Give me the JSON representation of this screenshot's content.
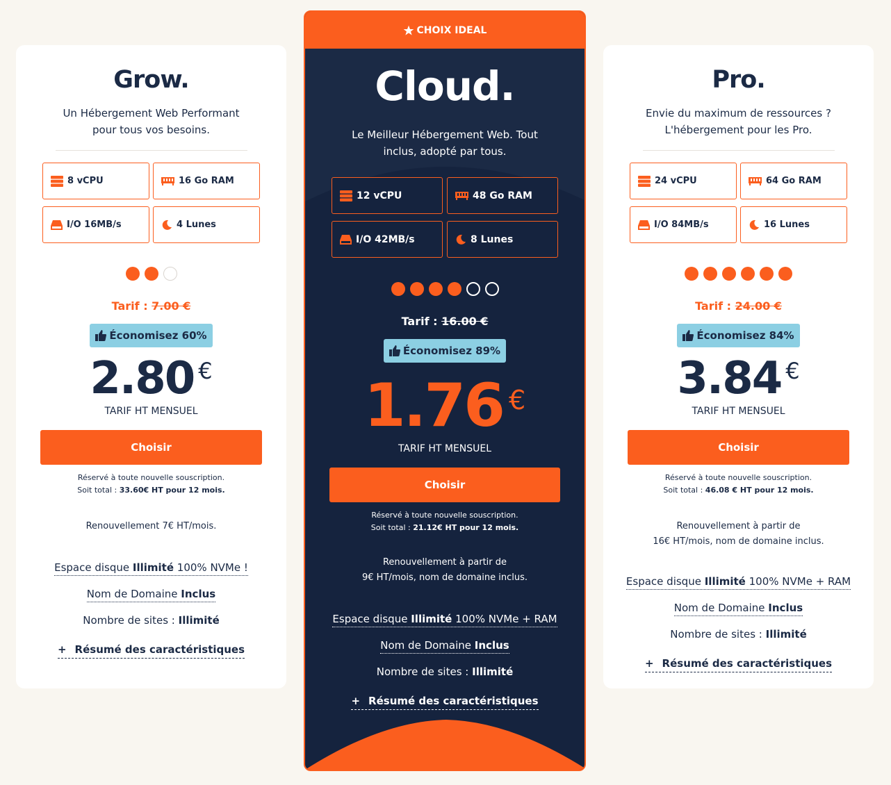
{
  "colors": {
    "accent": "#fb5e1e",
    "navy": "#15233e",
    "badge": "#8ccfe3",
    "background": "#f9f6f0"
  },
  "labels": {
    "tarif": "Tarif :",
    "tarif_ht": "TARIF HT MENSUEL",
    "choose": "Choisir",
    "reserved": "Réservé à toute nouvelle souscription.",
    "soit_total": "Soit total :",
    "disk_prefix": "Espace disque",
    "illimite": "Illimité",
    "domain_prefix": "Nom de Domaine",
    "inclus": "Inclus",
    "sites_prefix": "Nombre de sites :",
    "summary": "Résumé des caractéristiques",
    "plus": "+"
  },
  "icons": [
    "server-icon",
    "ram-icon",
    "disk-icon",
    "moon-icon",
    "star-icon",
    "thumbs-up-icon",
    "plus-icon"
  ],
  "plans": [
    {
      "id": "grow",
      "name": "Grow.",
      "desc_1": "Un Hébergement Web Performant",
      "desc_2": "pour tous vos besoins.",
      "vcpu": "8 vCPU",
      "ram": "16 Go RAM",
      "io": "I/O 16MB/s",
      "lunes": "4 Lunes",
      "level": 2,
      "level_max": 3,
      "old_price": "7.00 €",
      "save": "Économisez 60%",
      "price": "2.80",
      "currency": "€",
      "total": "33.60€ HT pour 12 mois.",
      "renew_1": "Renouvellement 7€ HT/mois.",
      "renew_2": "",
      "disk_suffix": "100% NVMe !"
    },
    {
      "id": "cloud",
      "badge": "CHOIX IDEAL",
      "name": "Cloud.",
      "desc_1": "Le Meilleur Hébergement Web. Tout",
      "desc_2": "inclus, adopté par tous.",
      "vcpu": "12 vCPU",
      "ram": "48 Go RAM",
      "io": "I/O 42MB/s",
      "lunes": "8 Lunes",
      "level": 4,
      "level_max": 6,
      "old_price": "16.00 €",
      "save": "Économisez 89%",
      "price": "1.76",
      "currency": "€",
      "total": "21.12€ HT pour 12 mois.",
      "renew_1": "Renouvellement à partir de",
      "renew_2": "9€ HT/mois, nom de domaine inclus.",
      "disk_suffix": "100% NVMe + RAM"
    },
    {
      "id": "pro",
      "name": "Pro.",
      "desc_1": "Envie du maximum de ressources ?",
      "desc_2": "L'hébergement pour les Pro.",
      "vcpu": "24 vCPU",
      "ram": "64 Go RAM",
      "io": "I/O 84MB/s",
      "lunes": "16 Lunes",
      "level": 6,
      "level_max": 6,
      "old_price": "24.00 €",
      "save": "Économisez 84%",
      "price": "3.84",
      "currency": "€",
      "total": "46.08 € HT pour 12 mois.",
      "renew_1": "Renouvellement à partir de",
      "renew_2": "16€ HT/mois, nom de domaine inclus.",
      "disk_suffix": "100% NVMe + RAM"
    }
  ]
}
